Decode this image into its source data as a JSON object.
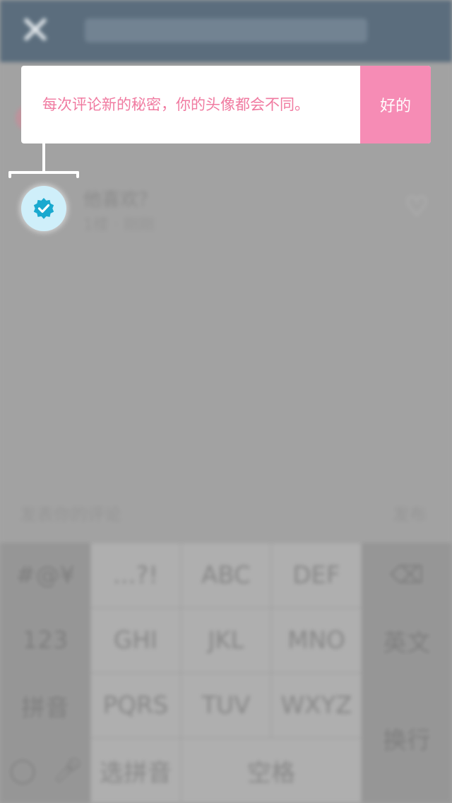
{
  "header": {
    "close_icon": "close-icon"
  },
  "comment": {
    "name": "他喜欢？",
    "meta": "1楼 · 刚刚"
  },
  "input": {
    "placeholder": "发表你的评论",
    "send_label": "发布"
  },
  "keyboard": {
    "row1": [
      "#@¥",
      "...?!",
      "ABC",
      "DEF"
    ],
    "row2": [
      "123",
      "GHI",
      "JKL",
      "MNO",
      "英文"
    ],
    "row3": [
      "拼音",
      "PQRS",
      "TUV",
      "WXYZ"
    ],
    "row4": [
      "选拼音",
      "空格"
    ],
    "enter_label": "换行",
    "icons": [
      "backspace-icon",
      "globe-icon",
      "microphone-icon"
    ]
  },
  "tooltip": {
    "message": "每次评论新的秘密，你的头像都会不同。",
    "ok_label": "好的"
  },
  "colors": {
    "accent_pink": "#f68cb5",
    "tip_text": "#f07aa0",
    "avatar_bg": "#cfeffa",
    "badge_blue": "#1aa9cf"
  }
}
